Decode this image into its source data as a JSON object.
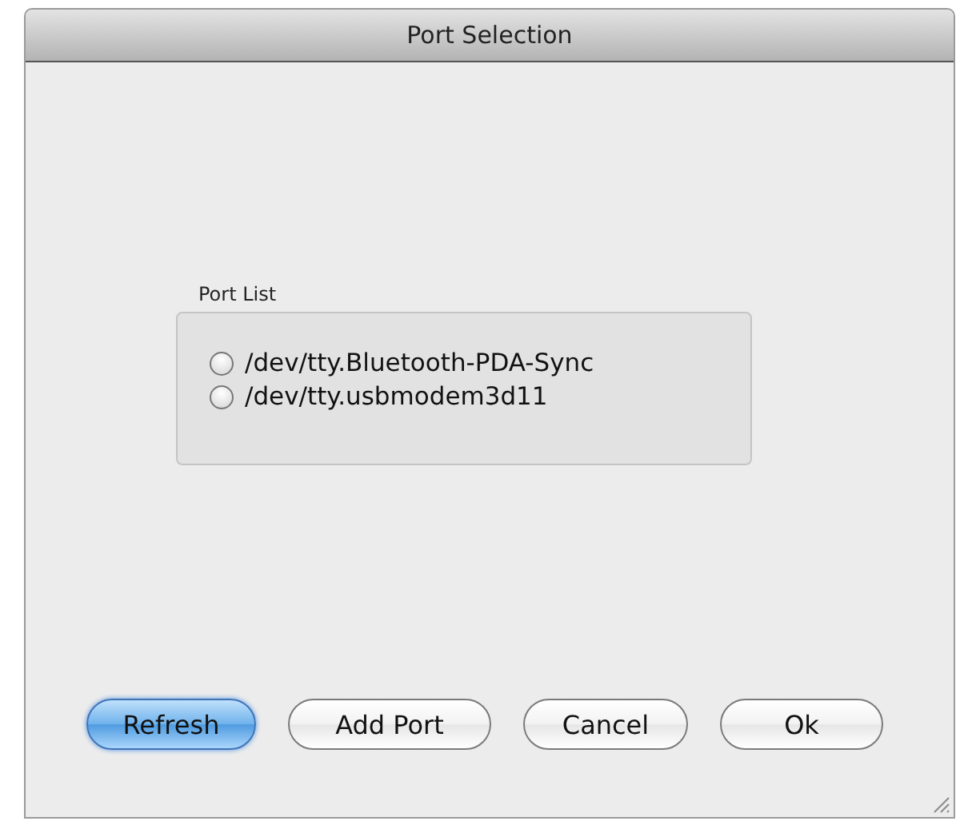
{
  "window": {
    "title": "Port Selection"
  },
  "port_list": {
    "label": "Port List",
    "ports": [
      {
        "label": "/dev/tty.Bluetooth-PDA-Sync",
        "selected": false
      },
      {
        "label": "/dev/tty.usbmodem3d11",
        "selected": false
      }
    ]
  },
  "buttons": [
    {
      "label": "Refresh",
      "default": true
    },
    {
      "label": "Add Port",
      "default": false
    },
    {
      "label": "Cancel",
      "default": false
    },
    {
      "label": "Ok",
      "default": false
    }
  ]
}
